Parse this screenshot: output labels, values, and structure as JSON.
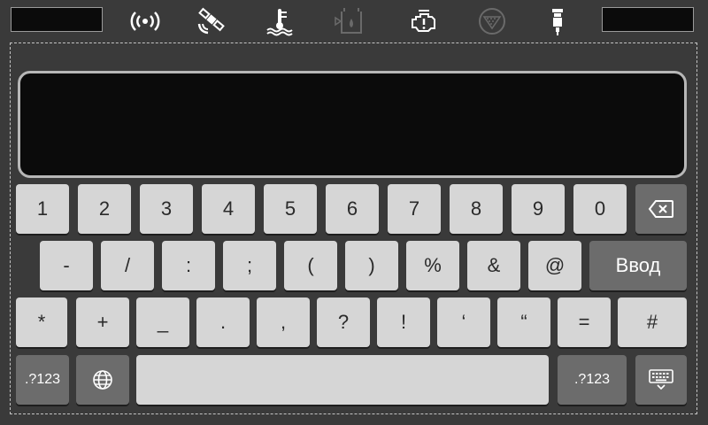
{
  "status_bar": {
    "icons": [
      "wireless-signal-icon",
      "satellite-icon",
      "coolant-temperature-icon",
      "fuel-tank-icon",
      "check-engine-icon",
      "filter-icon",
      "spark-plug-icon"
    ]
  },
  "display": {
    "value": ""
  },
  "keyboard": {
    "row1": [
      "1",
      "2",
      "3",
      "4",
      "5",
      "6",
      "7",
      "8",
      "9",
      "0"
    ],
    "row2": [
      "-",
      "/",
      ":",
      ";",
      "(",
      ")",
      "%",
      "&",
      "@"
    ],
    "enter_label": "Ввод",
    "row3": [
      "*",
      "+",
      "_",
      ".",
      ",",
      "?",
      "!",
      "‘",
      "“",
      "=",
      "#"
    ],
    "symbols_label_left": ".?123",
    "symbols_label_right": ".?123",
    "backspace_icon": "backspace-icon",
    "globe_icon": "globe-icon",
    "hide_keyboard_icon": "hide-keyboard-icon"
  },
  "colors": {
    "key_light": "#d6d6d6",
    "key_dark": "#6c6c6c",
    "background": "#3a3a3a",
    "display": "#0b0b0b"
  }
}
